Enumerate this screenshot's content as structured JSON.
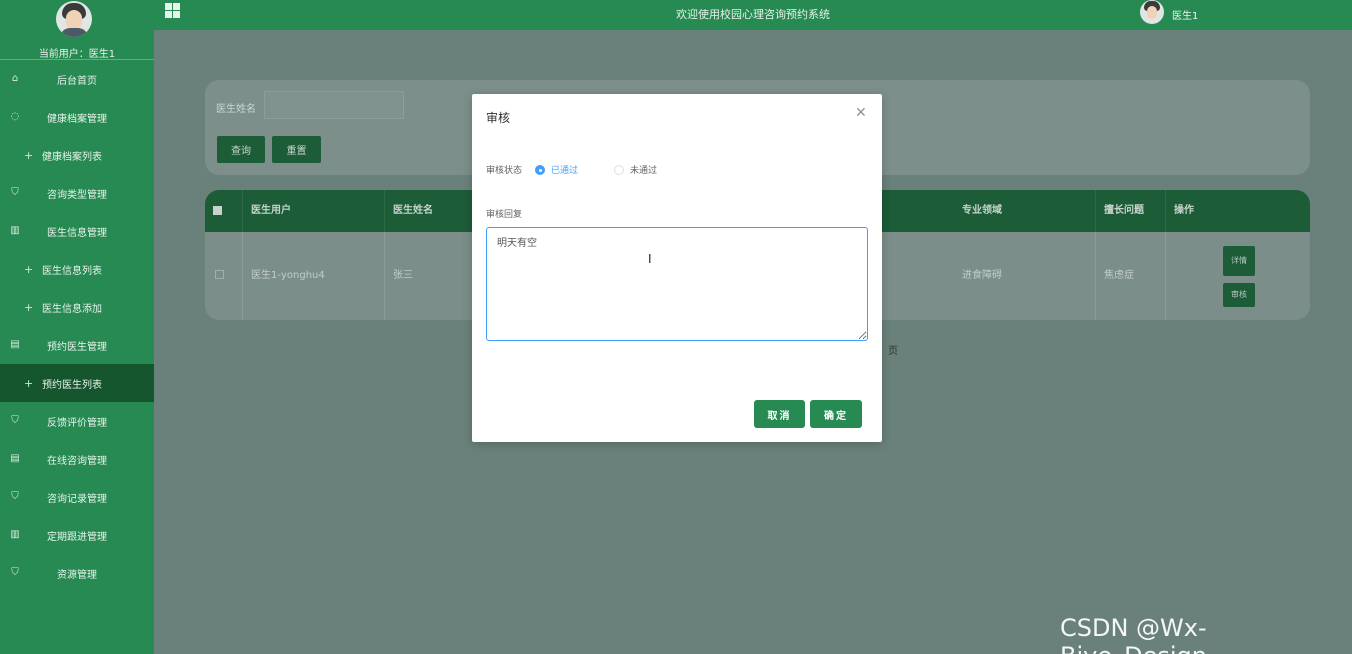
{
  "sidebar": {
    "current_user": "当前用户：医生1",
    "items": [
      {
        "label": "后台首页",
        "icon": "home-icon",
        "sub": false,
        "active": false
      },
      {
        "label": "健康档案管理",
        "icon": "chat-icon",
        "sub": false,
        "active": false
      },
      {
        "label": "健康档案列表",
        "icon": "plus-icon",
        "sub": true,
        "active": false
      },
      {
        "label": "咨询类型管理",
        "icon": "shield-icon",
        "sub": false,
        "active": false
      },
      {
        "label": "医生信息管理",
        "icon": "columns-icon",
        "sub": false,
        "active": false
      },
      {
        "label": "医生信息列表",
        "icon": "plus-icon",
        "sub": true,
        "active": false
      },
      {
        "label": "医生信息添加",
        "icon": "plus-icon",
        "sub": true,
        "active": false
      },
      {
        "label": "预约医生管理",
        "icon": "document-icon",
        "sub": false,
        "active": false
      },
      {
        "label": "预约医生列表",
        "icon": "plus-icon",
        "sub": true,
        "active": true
      },
      {
        "label": "反馈评价管理",
        "icon": "shield-icon",
        "sub": false,
        "active": false
      },
      {
        "label": "在线咨询管理",
        "icon": "document-icon",
        "sub": false,
        "active": false
      },
      {
        "label": "咨询记录管理",
        "icon": "shield-icon",
        "sub": false,
        "active": false
      },
      {
        "label": "定期跟进管理",
        "icon": "columns-icon",
        "sub": false,
        "active": false
      },
      {
        "label": "资源管理",
        "icon": "shield-icon",
        "sub": false,
        "active": false
      }
    ]
  },
  "header": {
    "title": "欢迎使用校园心理咨询预约系统",
    "user": "医生1"
  },
  "search": {
    "label": "医生姓名",
    "query_button": "查询",
    "reset_button": "重置"
  },
  "table": {
    "headers": [
      "医生用户",
      "医生姓名",
      "专业领域",
      "擅长问题",
      "操作"
    ],
    "row": {
      "user": "医生1-yonghu4",
      "name": "张三",
      "field": "进食障碍",
      "problem": "焦虑症",
      "detail_button": "详情",
      "review_button": "审核"
    }
  },
  "pager": {
    "suffix": "页"
  },
  "modal": {
    "title": "审核",
    "status_label": "审核状态",
    "options": [
      "已通过",
      "未通过"
    ],
    "selected": "已通过",
    "reply_label": "审核回复",
    "reply_value": "明天有空",
    "cancel_button": "取消",
    "confirm_button": "确定"
  },
  "watermark": "CSDN @Wx-Biye_Design",
  "colors": {
    "brand_green": "#268a52",
    "active_blue": "#409eff"
  }
}
